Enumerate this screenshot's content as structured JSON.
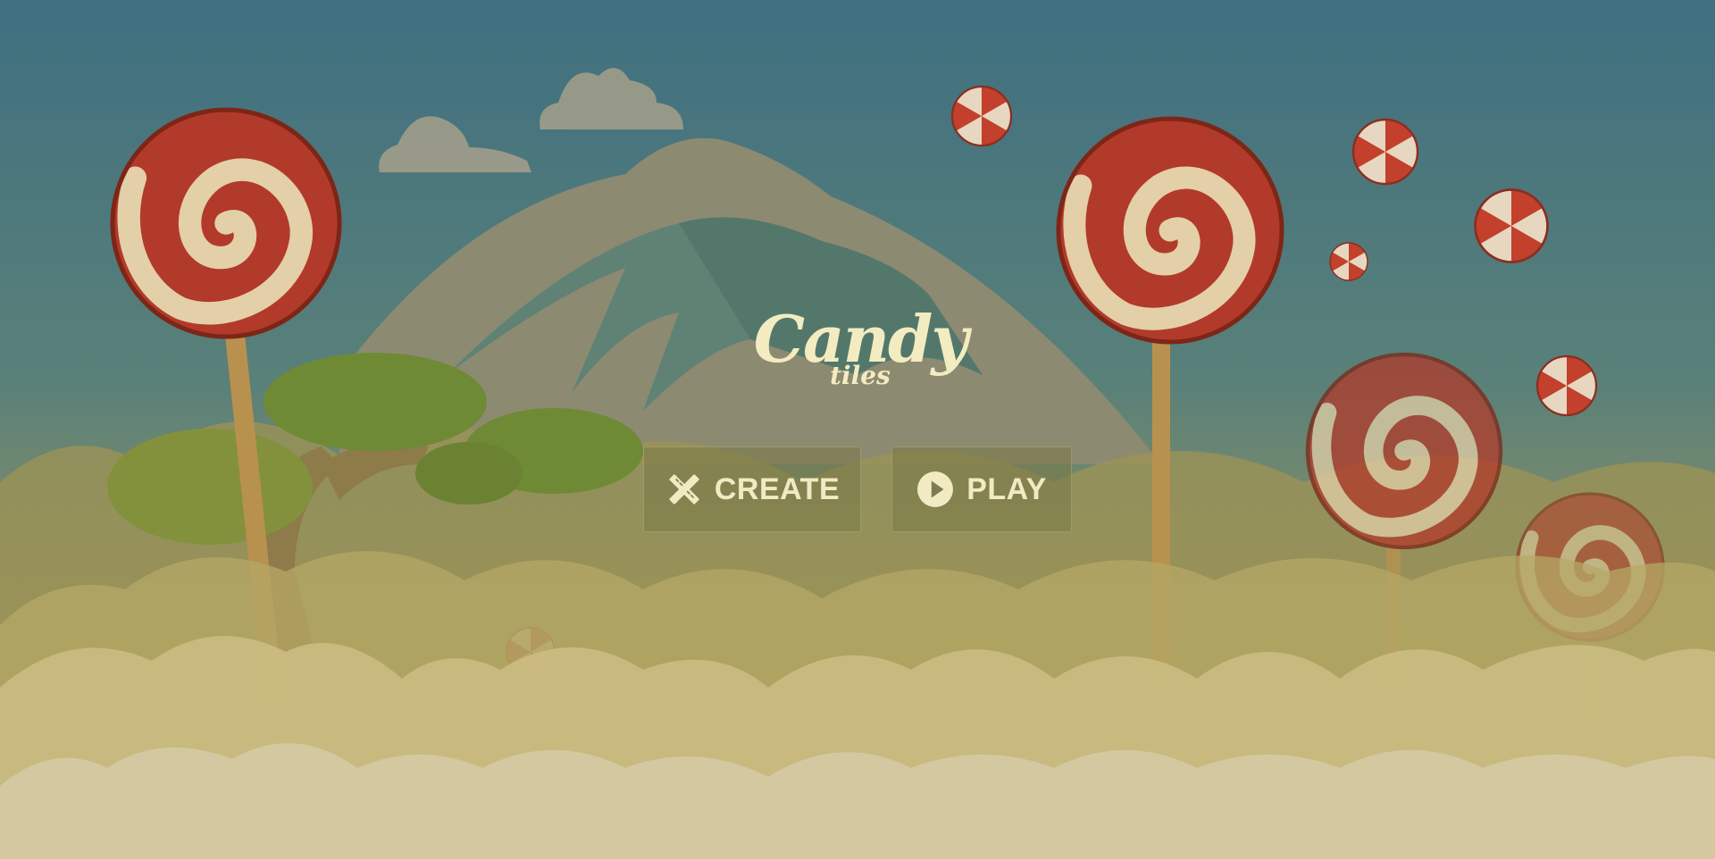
{
  "logo": {
    "title": "Candy",
    "subtitle": "tiles"
  },
  "buttons": {
    "create": {
      "label": "CREATE",
      "icon": "pencil-ruler-icon"
    },
    "play": {
      "label": "PLAY",
      "icon": "play-circle-icon"
    }
  },
  "colors": {
    "sky_top": "#3f6f80",
    "sky_bottom": "#a59a5c",
    "candy_red": "#b23a2a",
    "cream": "#f3ecc1",
    "cloud": "#d4c8a0"
  }
}
